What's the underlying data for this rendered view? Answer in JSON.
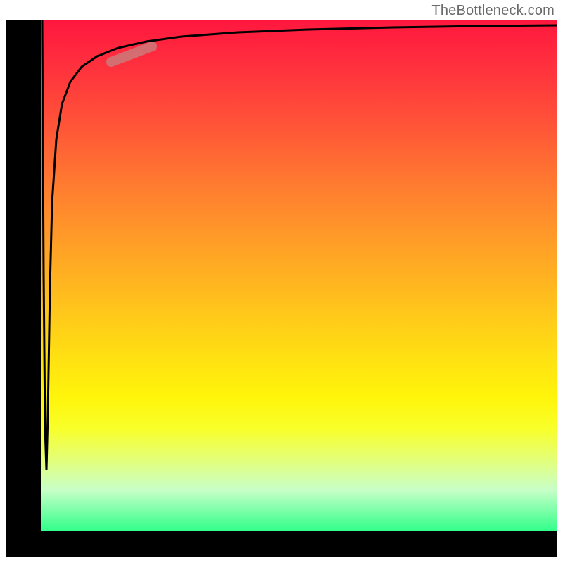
{
  "watermark": "TheBottleneck.com",
  "chart_data": {
    "type": "line",
    "title": "",
    "xlabel": "",
    "ylabel": "",
    "xlim": [
      0,
      100
    ],
    "ylim": [
      0,
      100
    ],
    "grid": false,
    "legend": false,
    "series": [
      {
        "name": "curve",
        "x": [
          0,
          0.5,
          1,
          1.5,
          2,
          2.5,
          3,
          4,
          5,
          7,
          10,
          15,
          20,
          30,
          50,
          70,
          100
        ],
        "y": [
          100,
          50,
          20,
          12,
          30,
          55,
          70,
          80,
          86,
          90,
          92,
          94,
          95.2,
          96.3,
          97.4,
          97.9,
          98.3
        ]
      }
    ],
    "highlight_segment": {
      "series": "curve",
      "x_range": [
        14,
        22
      ],
      "y_range": [
        93.5,
        95.5
      ]
    },
    "colors": {
      "curve": "#000000",
      "highlight": "#cc7a7a",
      "background_gradient_top": "#ff173e",
      "background_gradient_bottom": "#32ff8a"
    }
  }
}
